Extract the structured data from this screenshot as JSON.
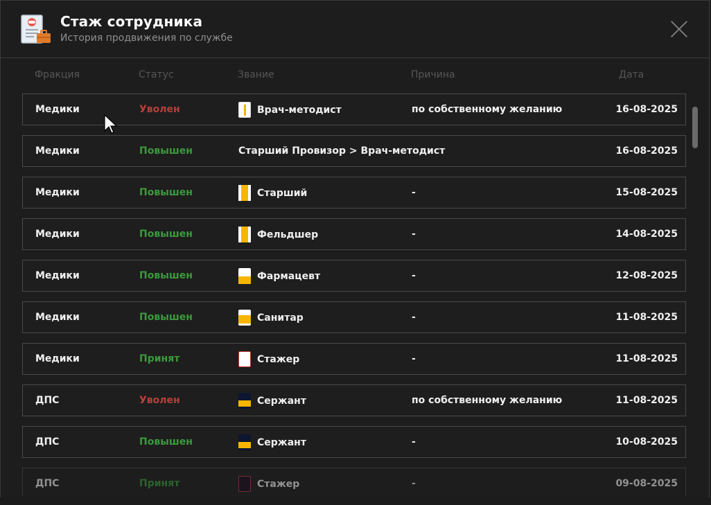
{
  "header": {
    "title": "Стаж сотрудника",
    "subtitle": "История продвижения по службе"
  },
  "columns": {
    "faction": "Фракция",
    "status": "Статус",
    "rank": "Звание",
    "reason": "Причина",
    "date": "Дата"
  },
  "rows": [
    {
      "faction": "Медики",
      "status": "Уволен",
      "rank": "Врач-методист",
      "reason": "по собственному желанию",
      "date": "16-08-2025"
    },
    {
      "faction": "Медики",
      "status": "Повышен",
      "rank": "Старший Провизор > Врач-методист",
      "reason": "",
      "date": "16-08-2025"
    },
    {
      "faction": "Медики",
      "status": "Повышен",
      "rank": "Старший",
      "reason": "-",
      "date": "15-08-2025"
    },
    {
      "faction": "Медики",
      "status": "Повышен",
      "rank": "Фельдшер",
      "reason": "-",
      "date": "14-08-2025"
    },
    {
      "faction": "Медики",
      "status": "Повышен",
      "rank": "Фармацевт",
      "reason": "-",
      "date": "12-08-2025"
    },
    {
      "faction": "Медики",
      "status": "Повышен",
      "rank": "Санитар",
      "reason": "-",
      "date": "11-08-2025"
    },
    {
      "faction": "Медики",
      "status": "Принят",
      "rank": "Стажер",
      "reason": "-",
      "date": "11-08-2025"
    },
    {
      "faction": "ДПС",
      "status": "Уволен",
      "rank": "Сержант",
      "reason": "по собственному желанию",
      "date": "11-08-2025"
    },
    {
      "faction": "ДПС",
      "status": "Повышен",
      "rank": "Сержант",
      "reason": "-",
      "date": "10-08-2025"
    },
    {
      "faction": "ДПС",
      "status": "Принят",
      "rank": "Стажер",
      "reason": "-",
      "date": "09-08-2025"
    }
  ],
  "colors": {
    "fired": "#b6403a",
    "promoted": "#3a9a3c",
    "accepted": "#3a9a3c"
  }
}
